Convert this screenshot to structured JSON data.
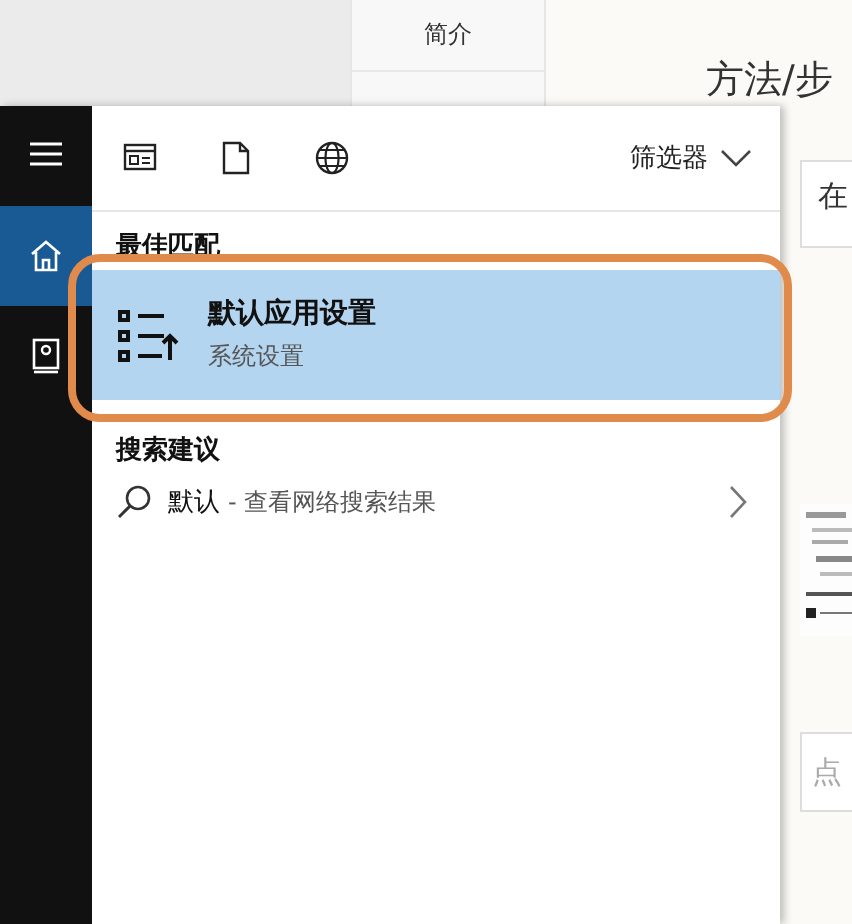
{
  "background_page": {
    "nav_items": [
      "简介"
    ],
    "heading": "方法/步",
    "side_boxes": [
      {
        "kind": "field",
        "text": "在"
      },
      {
        "kind": "picture"
      },
      {
        "kind": "button",
        "text": "点"
      }
    ]
  },
  "search_panel": {
    "rail": [
      {
        "kind": "menu",
        "selected": false
      },
      {
        "kind": "home",
        "selected": true
      },
      {
        "kind": "notebook",
        "selected": false
      }
    ],
    "toolbar": {
      "filters": [
        {
          "kind": "apps"
        },
        {
          "kind": "documents"
        },
        {
          "kind": "web"
        }
      ],
      "filter_menu": "筛选器"
    },
    "best_match": {
      "heading": "最佳匹配",
      "title": "默认应用设置",
      "subtitle": "系统设置",
      "selected": true,
      "annotated": true
    },
    "suggestions": {
      "heading": "搜索建议",
      "items": [
        {
          "query": "默认",
          "hint": "- 查看网络搜索结果"
        }
      ]
    }
  }
}
